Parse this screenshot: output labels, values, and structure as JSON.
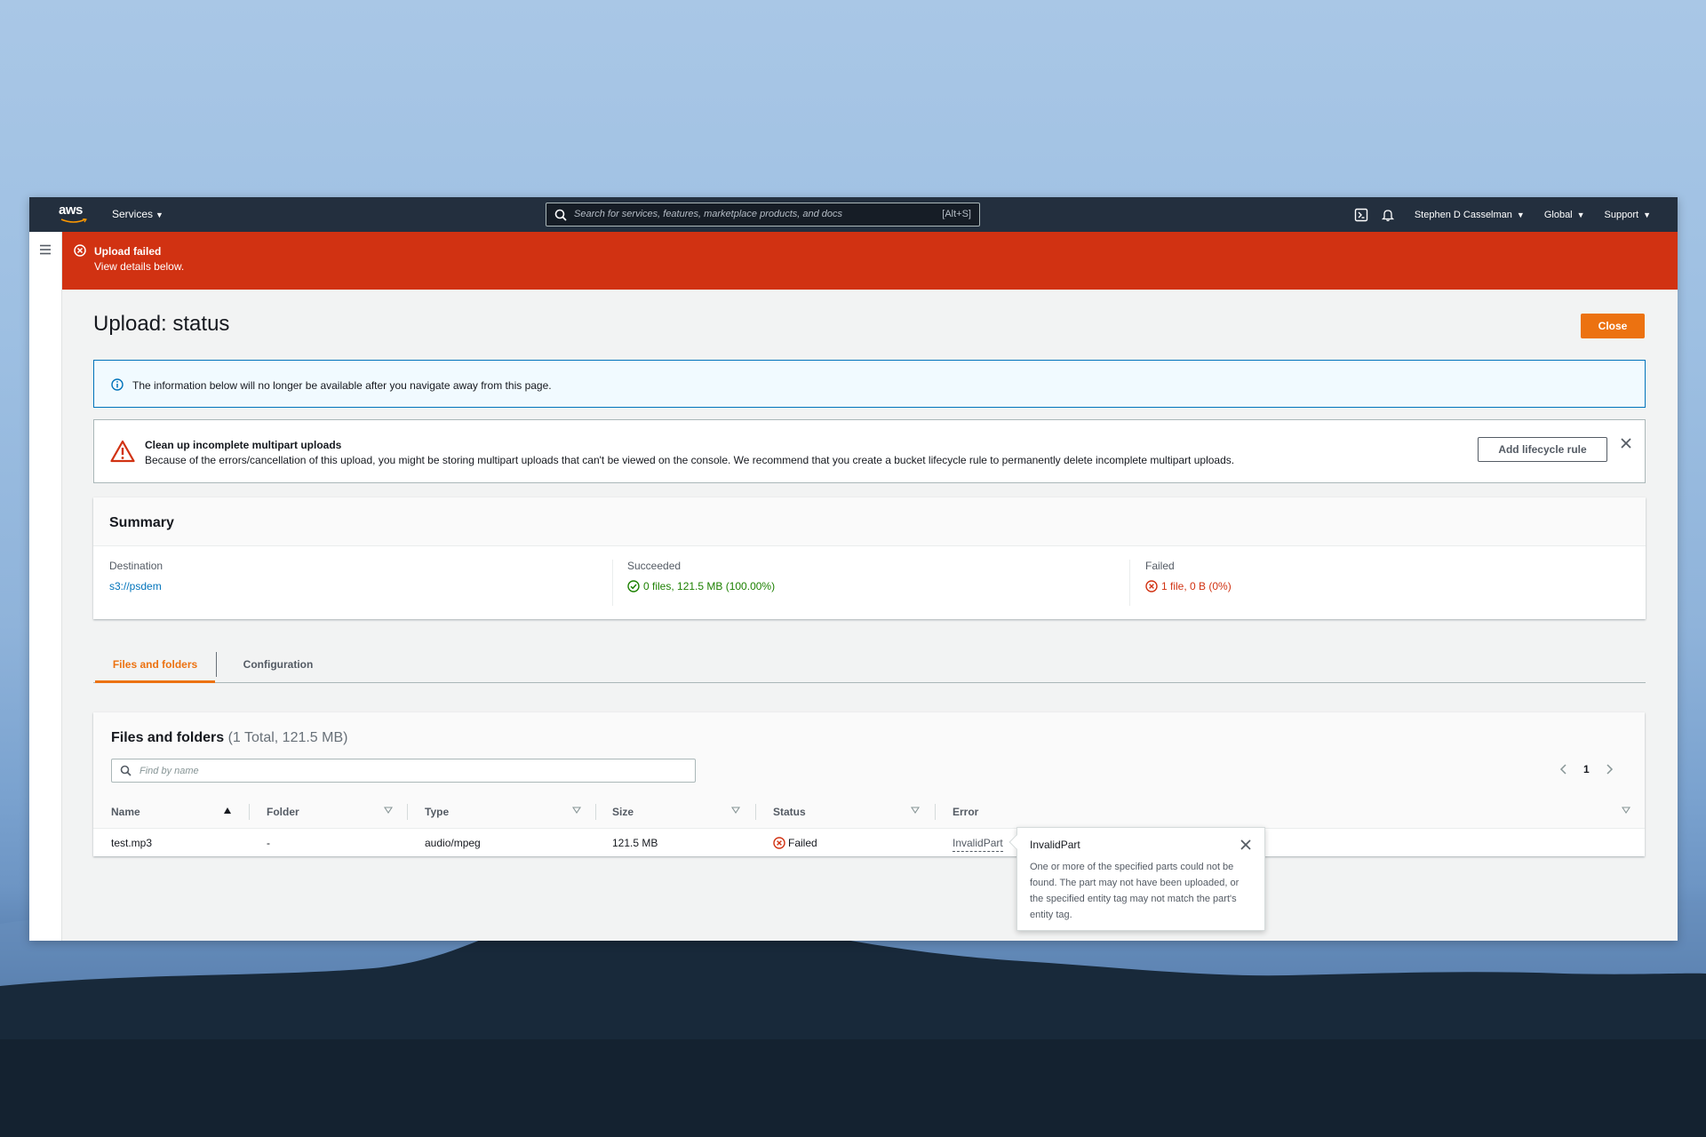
{
  "nav": {
    "logo": "aws",
    "services_label": "Services",
    "search_placeholder": "Search for services, features, marketplace products, and docs",
    "search_shortcut": "[Alt+S]",
    "user": "Stephen D Casselman",
    "region": "Global",
    "support": "Support"
  },
  "flash": {
    "title": "Upload failed",
    "subtitle": "View details below."
  },
  "page": {
    "title": "Upload: status",
    "close_label": "Close"
  },
  "info": {
    "text": "The information below will no longer be available after you navigate away from this page."
  },
  "warning": {
    "title": "Clean up incomplete multipart uploads",
    "text": "Because of the errors/cancellation of this upload, you might be storing multipart uploads that can't be viewed on the console. We recommend that you create a bucket lifecycle rule to permanently delete incomplete multipart uploads.",
    "button": "Add lifecycle rule"
  },
  "summary": {
    "title": "Summary",
    "destination_label": "Destination",
    "destination_value": "s3://psdem",
    "succeeded_label": "Succeeded",
    "succeeded_value": "0 files, 121.5 MB (100.00%)",
    "failed_label": "Failed",
    "failed_value": "1 file, 0 B (0%)"
  },
  "tabs": {
    "files": "Files and folders",
    "configuration": "Configuration"
  },
  "files": {
    "title": "Files and folders",
    "count": "(1 Total, 121.5 MB)",
    "find_placeholder": "Find by name",
    "page": "1",
    "columns": {
      "name": "Name",
      "folder": "Folder",
      "type": "Type",
      "size": "Size",
      "status": "Status",
      "error": "Error"
    },
    "rows": [
      {
        "name": "test.mp3",
        "folder": "-",
        "type": "audio/mpeg",
        "size": "121.5 MB",
        "status": "Failed",
        "error": "InvalidPart"
      }
    ]
  },
  "popover": {
    "title": "InvalidPart",
    "body": "One or more of the specified parts could not be found. The part may not have been uploaded, or the specified entity tag may not match the part's entity tag."
  },
  "colors": {
    "nav_bg": "#232f3e",
    "error_red": "#d13212",
    "accent_orange": "#ec7211",
    "link_blue": "#0073bb",
    "success_green": "#1d8102"
  }
}
